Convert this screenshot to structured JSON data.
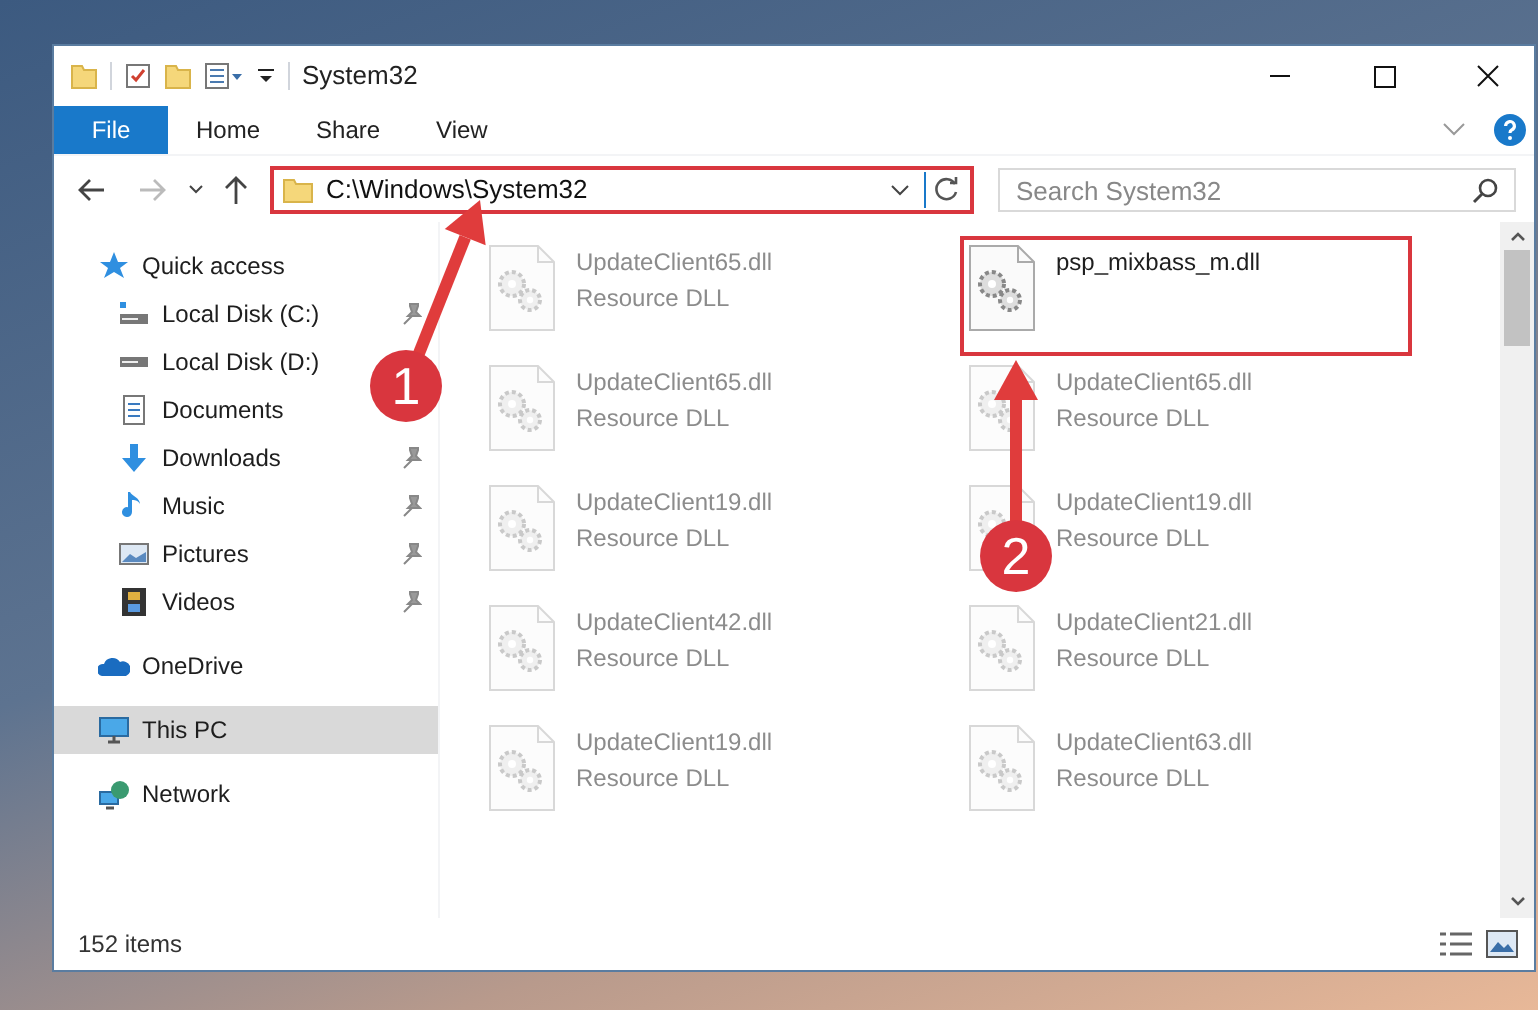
{
  "window": {
    "title": "System32"
  },
  "ribbon": {
    "file_button": "File",
    "tabs": [
      {
        "label": "Home",
        "selected": false
      },
      {
        "label": "Share",
        "selected": false
      },
      {
        "label": "View",
        "selected": false
      }
    ]
  },
  "address_bar": {
    "path": "C:\\Windows\\System32",
    "highlighted": true
  },
  "search": {
    "placeholder": "Search System32"
  },
  "navigation": [
    {
      "label": "Quick access",
      "selected": false,
      "children": [
        {
          "label": "Local Disk (C:)",
          "pinned": true
        },
        {
          "label": "Local Disk (D:)"
        },
        {
          "label": "Documents"
        },
        {
          "label": "Downloads",
          "pinned": true
        },
        {
          "label": "Music",
          "pinned": true
        },
        {
          "label": "Pictures",
          "pinned": true
        },
        {
          "label": "Videos",
          "pinned": true
        }
      ]
    },
    {
      "label": "OneDrive",
      "selected": false
    },
    {
      "label": "This PC",
      "selected": true
    },
    {
      "label": "Network",
      "selected": false
    }
  ],
  "files": [
    {
      "name": "UpdateClient65.dll",
      "type": "Resource DLL",
      "faded": true,
      "highlighted": false
    },
    {
      "name": "psp_mixbass_m.dll",
      "faded": false,
      "highlighted": true
    },
    {
      "name": "UpdateClient65.dll",
      "type": "Resource DLL",
      "faded": true,
      "highlighted": false
    },
    {
      "name": "UpdateClient65.dll",
      "type": "Resource DLL",
      "faded": true,
      "highlighted": false
    },
    {
      "name": "UpdateClient19.dll",
      "type": "Resource DLL",
      "faded": true,
      "highlighted": false
    },
    {
      "name": "UpdateClient19.dll",
      "type": "Resource DLL",
      "faded": true,
      "highlighted": false
    },
    {
      "name": "UpdateClient42.dll",
      "type": "Resource DLL",
      "faded": true,
      "highlighted": false
    },
    {
      "name": "UpdateClient21.dll",
      "type": "Resource DLL",
      "faded": true,
      "highlighted": false
    },
    {
      "name": "UpdateClient19.dll",
      "type": "Resource DLL",
      "faded": true,
      "highlighted": false
    },
    {
      "name": "UpdateClient63.dll",
      "type": "Resource DLL",
      "faded": true,
      "highlighted": false
    }
  ],
  "status_bar": {
    "item_count": "152 items"
  },
  "callouts": [
    {
      "number": "1"
    },
    {
      "number": "2"
    }
  ]
}
